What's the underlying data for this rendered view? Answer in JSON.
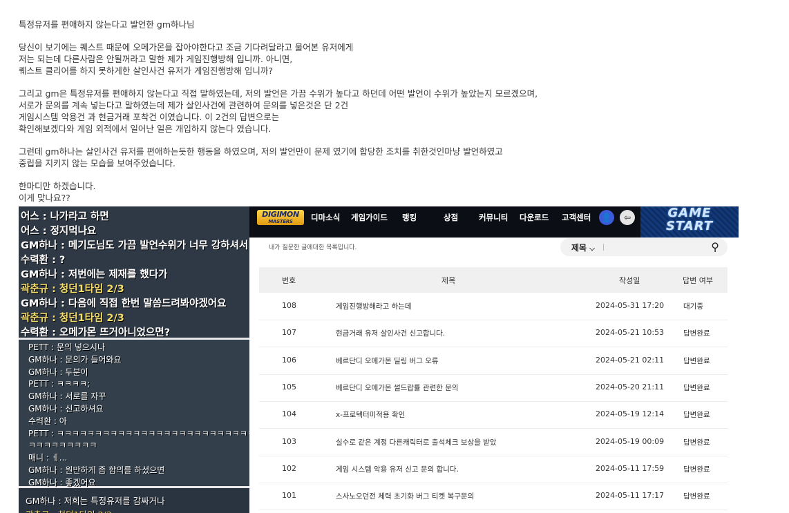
{
  "post": {
    "paragraphs": [
      [
        "특정유저를 편애하지 않는다고 발언한 gm하나님"
      ],
      [
        "당신이 보기에는 퀘스트 때문에 오메가몬을 잡아야한다고 조금 기다려달라고 물어본 유저에게",
        "저는 되는데 다른사람은 안될꺼라고 말한 제가 게임진행방해 입니까. 아니면,",
        "퀘스트 클리어를 하지 못하게한 살인사건 유저가 게임진행방해 입니까?"
      ],
      [
        "그리고 gm은 특정유저를 편애하지 않는다고 직접 말하였는데, 저의 발언은 가끔 수위가 높다고 하던데 어떤 발언이 수위가 높았는지 모르겠으며,",
        "서로가 문의를 계속 넣는다고 말하였는데 제가 살인사건에 관련하여 문의를 넣은것은 단 2건",
        "게임시스템 악용건 과 현금거래 포착건 이였습니다. 이 2건의 답변으로는",
        "확인해보겠다와 게임 외적에서 일어난 일은 개입하지 않는다 였습니다."
      ],
      [
        "그런데 gm하나는 살인사건 유저를 편애하는듯한 행동을 하였으며, 저의 발언만이 문제 였기에 합당한 조치를 취한것인마냥 발언하였고",
        "중립을 지키지 않는 모습을 보여주었습니다."
      ],
      [
        "한마디만 하겠습니다.",
        "이게 맞나요??"
      ]
    ]
  },
  "chat": {
    "top_lines": [
      {
        "text": "어스 : 나가라고 하면",
        "party": false
      },
      {
        "text": "어스 : 정지먹나요",
        "party": false
      },
      {
        "text": "GM하나 : 메기도님도 가끔 발언수위가 너무 강하셔서",
        "party": false
      },
      {
        "text": "수력환 : ?",
        "party": false
      },
      {
        "text": "GM하나 : 저번에는 제재를 했다가",
        "party": false
      },
      {
        "text": "곽춘규 : 청던1타임 2/3",
        "party": true
      },
      {
        "text": "GM하나 : 다음에 직접 한번 말씀드려봐야겠어요",
        "party": false
      },
      {
        "text": "곽춘규 : 청던1타임 2/3",
        "party": true
      },
      {
        "text": "수력환 : 오메가몬 뜨거아니었으면?",
        "party": false
      }
    ],
    "mid_lines": [
      "PETT : 문의 넣으시나",
      "GM하나 : 문의가 들어와요",
      "GM하나 : 두분이",
      "PETT : ㅋㅋㅋㅋ;",
      "GM하나 : 서로를 자꾸",
      "GM하나 : 신고하셔요",
      "수력환 : 아",
      "PETT : ㅋㅋㅋㅋㅋㅋㅋㅋㅋㅋㅋㅋㅋㅋㅋㅋㅋㅋㅋㅋㅋㅋㅋㅋㅋㅋㅋ",
      "ㅋㅋㅋㅋㅋㅋㅋㅋㅋ",
      "매니 : ㅔ...",
      "GM하나 : 원만하게 좀 합의를 하셨으면",
      "GM하나 : 좋겠어요"
    ],
    "bottom_lines": [
      {
        "text": "GM하나 : 저희는 특정유저를 감싸거나",
        "party": false
      },
      {
        "text": "곽춘규 : 청던1타임 2/3",
        "party": true
      }
    ]
  },
  "site": {
    "logo": {
      "line1": "DIGIMON",
      "line2": "MASTERS"
    },
    "nav": [
      "디마소식",
      "게임가이드",
      "랭킹",
      "상점",
      "커뮤니티",
      "다운로드",
      "고객센터"
    ],
    "user_icon": "user-icon",
    "logout_icon": "logout-icon",
    "game_start": {
      "line1": "GAME",
      "line2": "START"
    },
    "subtitle": "내가 질문한 글에대한 목록입니다.",
    "search": {
      "select_label": "제목",
      "select_arrow": "⌄",
      "placeholder": "",
      "icon": "search-icon"
    },
    "table": {
      "headers": [
        "번호",
        "제목",
        "작성일",
        "답변 여부"
      ],
      "rows": [
        {
          "no": "108",
          "title": "게임진행방해라고 하는데",
          "date": "2024-05-31 17:20",
          "status": "대기중"
        },
        {
          "no": "107",
          "title": "현금거래 유저 살인사건 신고합니다.",
          "date": "2024-05-21 10:53",
          "status": "답변완료"
        },
        {
          "no": "106",
          "title": "베르단디 오메가몬 딜링 버그 오류",
          "date": "2024-05-21 02:11",
          "status": "답변완료"
        },
        {
          "no": "105",
          "title": "베르단디 오메가몬 썰드랍률 관련한 문의",
          "date": "2024-05-20 21:11",
          "status": "답변완료"
        },
        {
          "no": "104",
          "title": "x-프로텍터미적용 확인",
          "date": "2024-05-19 12:14",
          "status": "답변완료"
        },
        {
          "no": "103",
          "title": "실수로 같은 계정 다른캐릭터로 출석체크 보상을 받았",
          "date": "2024-05-19 00:09",
          "status": "답변완료"
        },
        {
          "no": "102",
          "title": "게임 시스템 악용 유저 신고 문의 합니다.",
          "date": "2024-05-11 17:59",
          "status": "답변완료"
        },
        {
          "no": "101",
          "title": "스사노오던전 체력 초기화 버그 티켓 복구문의",
          "date": "2024-05-11 17:17",
          "status": "답변완료"
        }
      ]
    }
  }
}
